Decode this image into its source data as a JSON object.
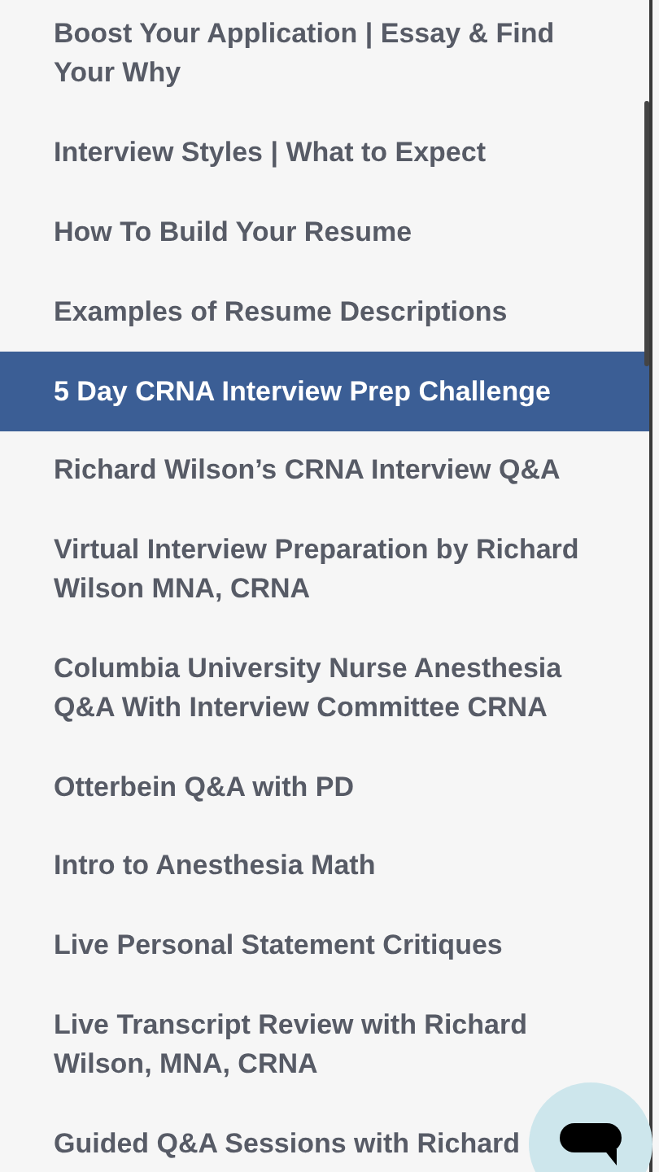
{
  "lessons": [
    {
      "label": "Boost Your Application | Essay & Find Your Why",
      "selected": false
    },
    {
      "label": "Interview Styles | What to Expect",
      "selected": false
    },
    {
      "label": "How To Build Your Resume",
      "selected": false
    },
    {
      "label": "Examples of Resume Descriptions",
      "selected": false
    },
    {
      "label": "5 Day CRNA Interview Prep Challenge",
      "selected": true
    },
    {
      "label": "Richard Wilson’s CRNA Interview Q&A",
      "selected": false
    },
    {
      "label": "Virtual Interview Preparation by Richard Wilson MNA, CRNA",
      "selected": false
    },
    {
      "label": "Columbia University Nurse Anesthesia Q&A With Interview Committee CRNA",
      "selected": false
    },
    {
      "label": "Otterbein Q&A with PD",
      "selected": false
    },
    {
      "label": "Intro to Anesthesia Math",
      "selected": false
    },
    {
      "label": "Live Personal Statement Critiques",
      "selected": false
    },
    {
      "label": "Live Transcript Review with Richard Wilson, MNA, CRNA",
      "selected": false
    },
    {
      "label": "Guided Q&A Sessions with Richard",
      "selected": false
    }
  ]
}
